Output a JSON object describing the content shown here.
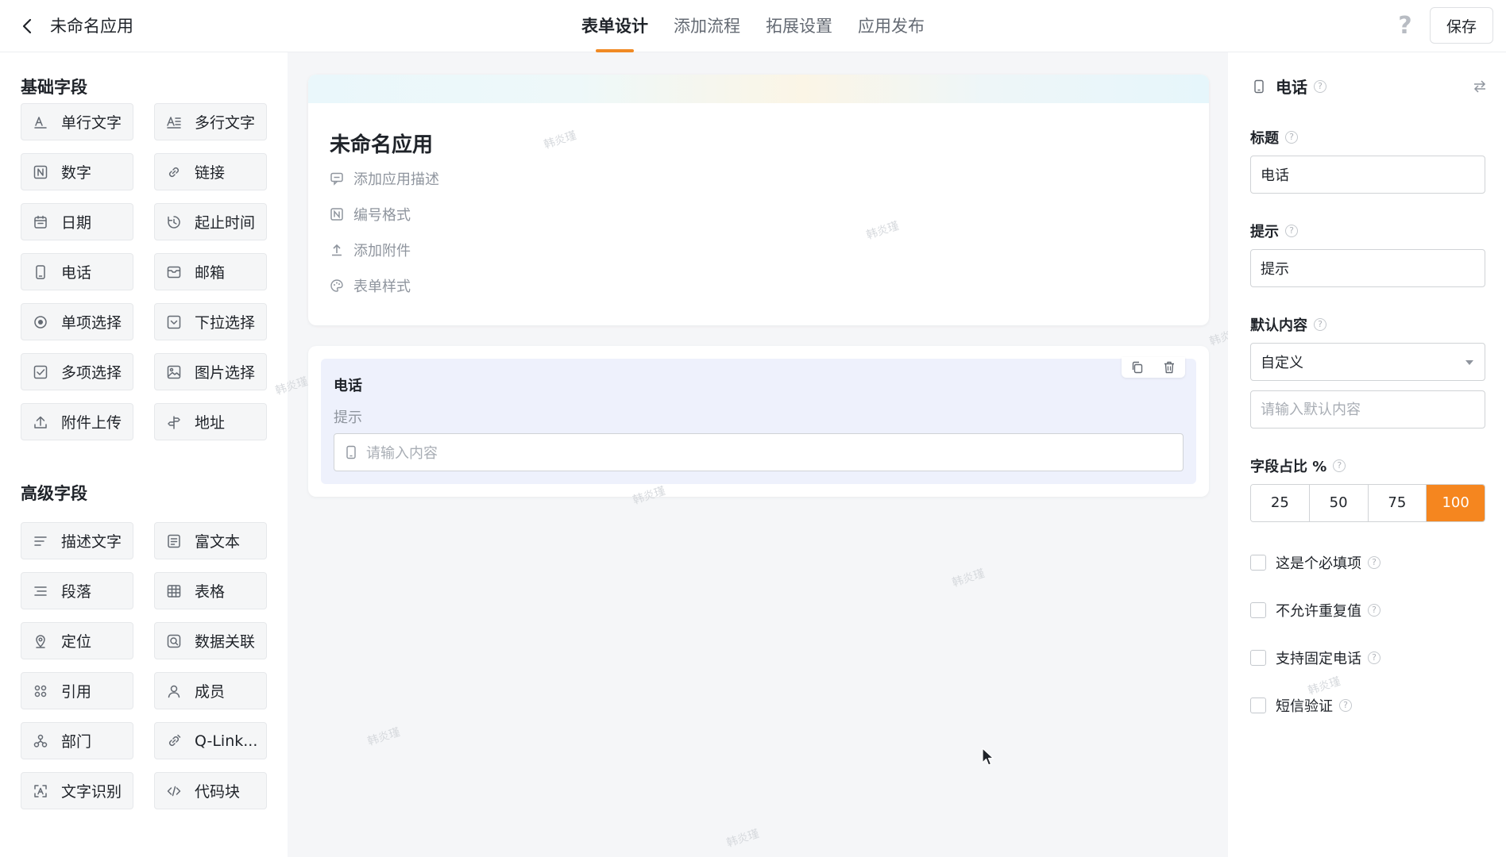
{
  "header": {
    "app_title": "未命名应用",
    "tabs": [
      {
        "label": "表单设计",
        "active": true
      },
      {
        "label": "添加流程",
        "active": false
      },
      {
        "label": "拓展设置",
        "active": false
      },
      {
        "label": "应用发布",
        "active": false
      }
    ],
    "help": "?",
    "save_label": "保存"
  },
  "left": {
    "basic_title": "基础字段",
    "basic_fields": [
      {
        "label": "单行文字",
        "icon": "text-single-icon"
      },
      {
        "label": "多行文字",
        "icon": "text-multi-icon"
      },
      {
        "label": "数字",
        "icon": "number-icon"
      },
      {
        "label": "链接",
        "icon": "link-icon"
      },
      {
        "label": "日期",
        "icon": "calendar-icon"
      },
      {
        "label": "起止时间",
        "icon": "time-range-icon"
      },
      {
        "label": "电话",
        "icon": "phone-icon"
      },
      {
        "label": "邮箱",
        "icon": "mail-icon"
      },
      {
        "label": "单项选择",
        "icon": "radio-icon"
      },
      {
        "label": "下拉选择",
        "icon": "dropdown-icon"
      },
      {
        "label": "多项选择",
        "icon": "checkbox-icon"
      },
      {
        "label": "图片选择",
        "icon": "image-icon"
      },
      {
        "label": "附件上传",
        "icon": "upload-icon"
      },
      {
        "label": "地址",
        "icon": "address-icon"
      }
    ],
    "advanced_title": "高级字段",
    "advanced_fields": [
      {
        "label": "描述文字",
        "icon": "description-icon"
      },
      {
        "label": "富文本",
        "icon": "rich-text-icon"
      },
      {
        "label": "段落",
        "icon": "paragraph-icon"
      },
      {
        "label": "表格",
        "icon": "table-icon"
      },
      {
        "label": "定位",
        "icon": "location-icon"
      },
      {
        "label": "数据关联",
        "icon": "data-link-icon"
      },
      {
        "label": "引用",
        "icon": "reference-icon"
      },
      {
        "label": "成员",
        "icon": "member-icon"
      },
      {
        "label": "部门",
        "icon": "department-icon"
      },
      {
        "label": "Q-Link...",
        "icon": "qlink-icon"
      },
      {
        "label": "文字识别",
        "icon": "ocr-icon"
      },
      {
        "label": "代码块",
        "icon": "code-icon"
      }
    ]
  },
  "canvas": {
    "form_title": "未命名应用",
    "meta": [
      {
        "label": "添加应用描述",
        "icon": "comment-icon"
      },
      {
        "label": "编号格式",
        "icon": "number-format-icon"
      },
      {
        "label": "添加附件",
        "icon": "upload-icon"
      },
      {
        "label": "表单样式",
        "icon": "palette-icon"
      }
    ],
    "field": {
      "label": "电话",
      "hint": "提示",
      "placeholder": "请输入内容"
    },
    "watermark": "韩炎瑾"
  },
  "right": {
    "title": "电话",
    "title_label": "标题",
    "title_value": "电话",
    "hint_label": "提示",
    "hint_value": "提示",
    "default_label": "默认内容",
    "default_select": "自定义",
    "default_placeholder": "请输入默认内容",
    "ratio_label": "字段占比 %",
    "ratio_options": [
      "25",
      "50",
      "75",
      "100"
    ],
    "ratio_selected": "100",
    "checks": [
      {
        "label": "这是个必填项",
        "checked": false
      },
      {
        "label": "不允许重复值",
        "checked": false
      },
      {
        "label": "支持固定电话",
        "checked": false
      },
      {
        "label": "短信验证",
        "checked": false
      }
    ],
    "accent_color": "#f5861f"
  }
}
